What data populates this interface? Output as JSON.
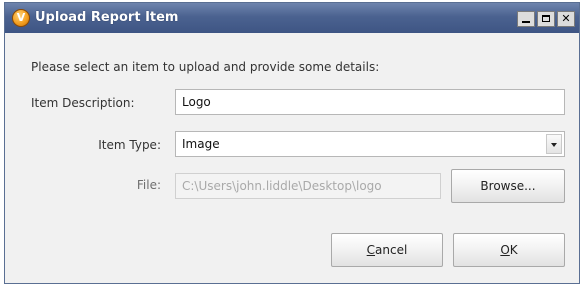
{
  "window": {
    "title": "Upload Report Item",
    "app_icon_letter": "V"
  },
  "instruction": "Please select an item to upload and provide some details:",
  "form": {
    "description_label": "Item Description:",
    "description_value": "Logo",
    "type_label": "Item Type:",
    "type_value": "Image",
    "file_label": "File:",
    "file_value": "C:\\Users\\john.liddle\\Desktop\\logo"
  },
  "buttons": {
    "browse": "Browse...",
    "cancel_accel": "C",
    "cancel_rest": "ancel",
    "ok_accel": "O",
    "ok_rest": "K"
  },
  "icons": {
    "app": "app-logo-icon",
    "minimize": "minimize-icon",
    "maximize": "maximize-icon",
    "close": "close-icon",
    "dropdown": "chevron-down-icon"
  }
}
